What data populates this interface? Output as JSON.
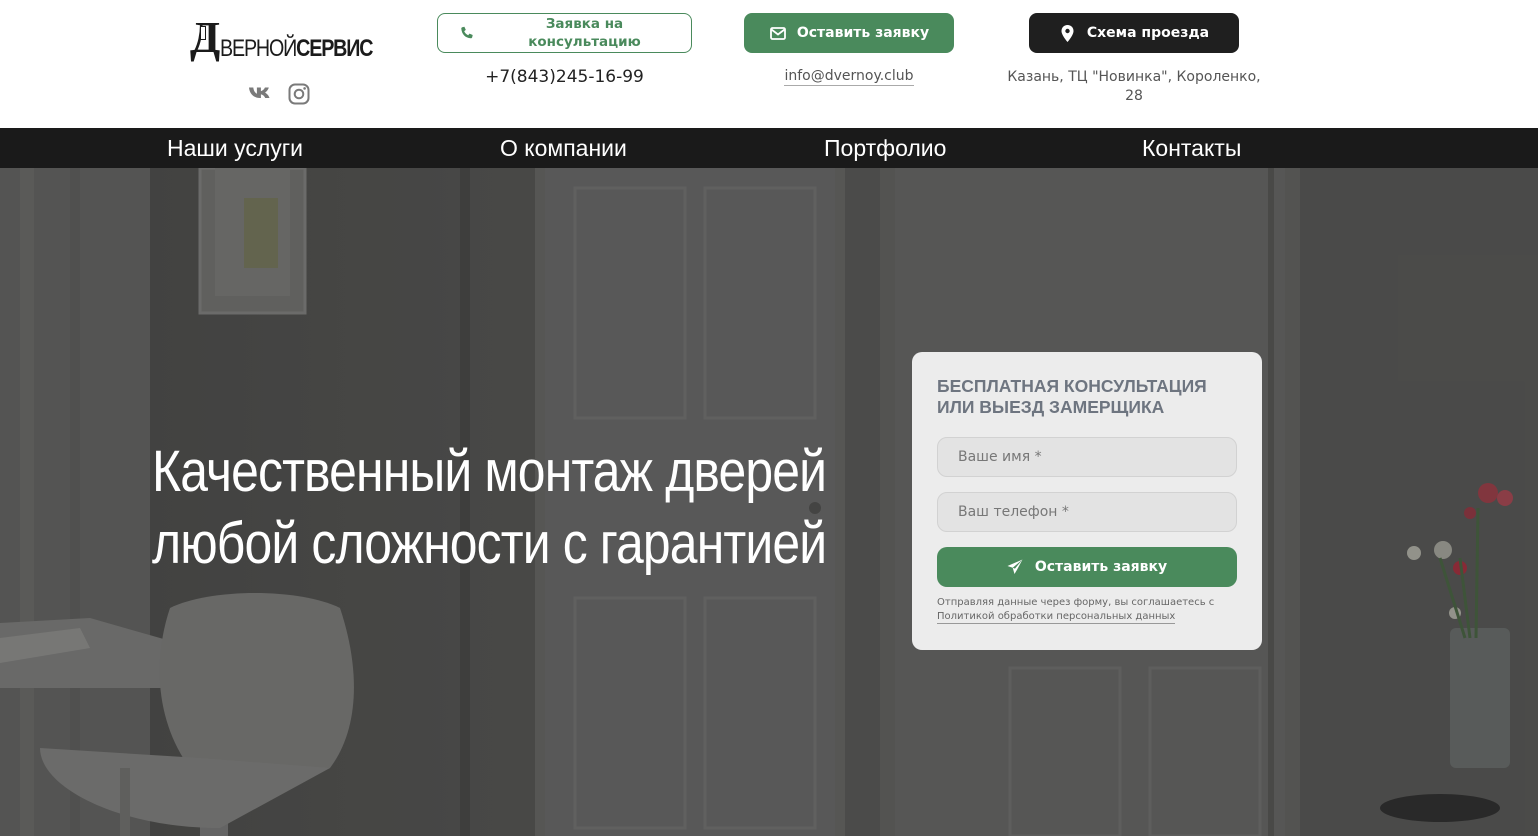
{
  "header": {
    "logo": {
      "letter": "Д",
      "text_light": "ВЕРНОЙ",
      "text_bold": "СЕРВИС"
    },
    "social": {
      "vk_icon": "vk-icon",
      "instagram_icon": "instagram-icon"
    },
    "consult_button": {
      "label": "Заявка на консультацию",
      "icon": "phone-icon"
    },
    "request_button": {
      "label": "Оставить заявку",
      "icon": "envelope-icon"
    },
    "route_button": {
      "label": "Схема проезда",
      "icon": "map-pin-icon"
    },
    "phone": "+7(843)245-16-99",
    "email": "info@dvernoy.club",
    "address": "Казань, ТЦ \"Новинка\", Короленко, 28"
  },
  "nav": {
    "items": [
      {
        "label": "Наши услуги"
      },
      {
        "label": "О компании"
      },
      {
        "label": "Портфолио"
      },
      {
        "label": "Контакты"
      }
    ]
  },
  "hero": {
    "title_line1": "Качественный монтаж дверей",
    "title_line2": "любой сложности с гарантией"
  },
  "form": {
    "title": "Бесплатная консультация или выезд замерщика",
    "name_placeholder": "Ваше имя *",
    "phone_placeholder": "Ваш телефон *",
    "name_value": "",
    "phone_value": "",
    "submit_label": "Оставить заявку",
    "submit_icon": "paper-plane-icon",
    "consent_text": "Отправляя данные через форму, вы соглашаетесь с",
    "consent_link": "Политикой обработки персональных данных"
  },
  "colors": {
    "accent_green": "#4a8a5c",
    "dark": "#1f1f1f",
    "nav_bg": "#1a1a1a",
    "form_title": "#6e7580"
  }
}
